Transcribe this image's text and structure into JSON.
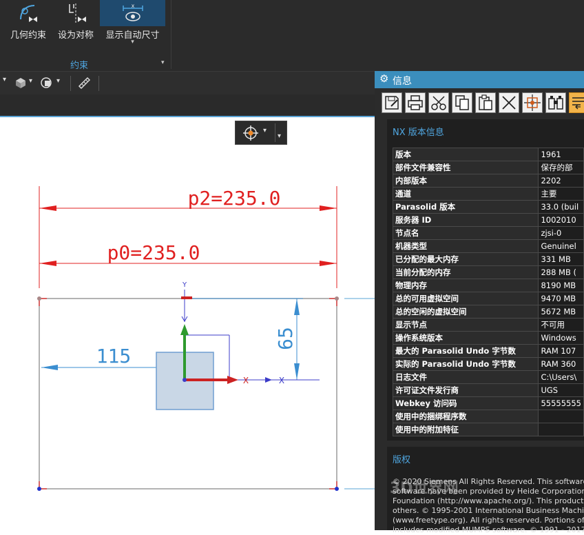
{
  "ribbon": {
    "buttons": [
      {
        "label": "几何约束",
        "icon": "geometric-constraint-icon"
      },
      {
        "label": "设为对称",
        "icon": "make-symmetric-icon"
      },
      {
        "label": "显示自动尺寸",
        "icon": "show-auto-dimensions-icon"
      }
    ],
    "group_label": "约束"
  },
  "panel": {
    "title": "信息",
    "section_title": "NX 版本信息",
    "rows": [
      {
        "key": "版本",
        "value": "1961"
      },
      {
        "key": "部件文件兼容性",
        "value": "保存的部"
      },
      {
        "key": "内部版本",
        "value": "2202"
      },
      {
        "key": "通道",
        "value": "主要"
      },
      {
        "key": "Parasolid 版本",
        "value": "33.0 (buil"
      },
      {
        "key": "服务器 ID",
        "value": "1002010"
      },
      {
        "key": "节点名",
        "value": "zjsi-0"
      },
      {
        "key": "机器类型",
        "value": "Genuinel"
      },
      {
        "key": "已分配的最大内存",
        "value": "331 MB"
      },
      {
        "key": "当前分配的内存",
        "value": "288 MB ("
      },
      {
        "key": "物理内存",
        "value": "8190 MB"
      },
      {
        "key": "总的可用虚拟空间",
        "value": "9470 MB"
      },
      {
        "key": "总的空闲的虚拟空间",
        "value": "5672 MB"
      },
      {
        "key": "显示节点",
        "value": "不可用"
      },
      {
        "key": "操作系统版本",
        "value": "Windows"
      },
      {
        "key": "最大的 Parasolid Undo 字节数",
        "value": "RAM 107"
      },
      {
        "key": "实际的 Parasolid Undo 字节数",
        "value": "RAM 360"
      },
      {
        "key": "日志文件",
        "value": "C:\\Users\\"
      },
      {
        "key": "许可证文件发行商",
        "value": "UGS"
      },
      {
        "key": "Webkey 访问码",
        "value": "55555555"
      },
      {
        "key": "使用中的捆绑程序数",
        "value": ""
      },
      {
        "key": "使用中的附加特征",
        "value": ""
      }
    ],
    "copyright_title": "版权",
    "copyright_lines": [
      "© 2020 Siemens All Rights Reserved. This software",
      "software have been provided by Heide Corporation.",
      "Foundation (http://www.apache.org/). This product in",
      "others. © 1995-2001 International Business Machine",
      "(www.freetype.org). All rights reserved. Portions of th",
      "includes modified MUMPS software. © 1991 - 2017"
    ],
    "watermark": "3D世界网"
  },
  "sketch": {
    "dim_p2": "p2=235.0",
    "dim_p0": "p0=235.0",
    "dim_115": "115",
    "dim_65": "65",
    "axis_y": "Y",
    "axis_x": "X",
    "colors": {
      "dimension": "#e02020",
      "driving": "#3b8ed0",
      "accent": "#3b8ebd",
      "x_axis": "#cc2222",
      "y_axis": "#2e9a2e"
    }
  }
}
